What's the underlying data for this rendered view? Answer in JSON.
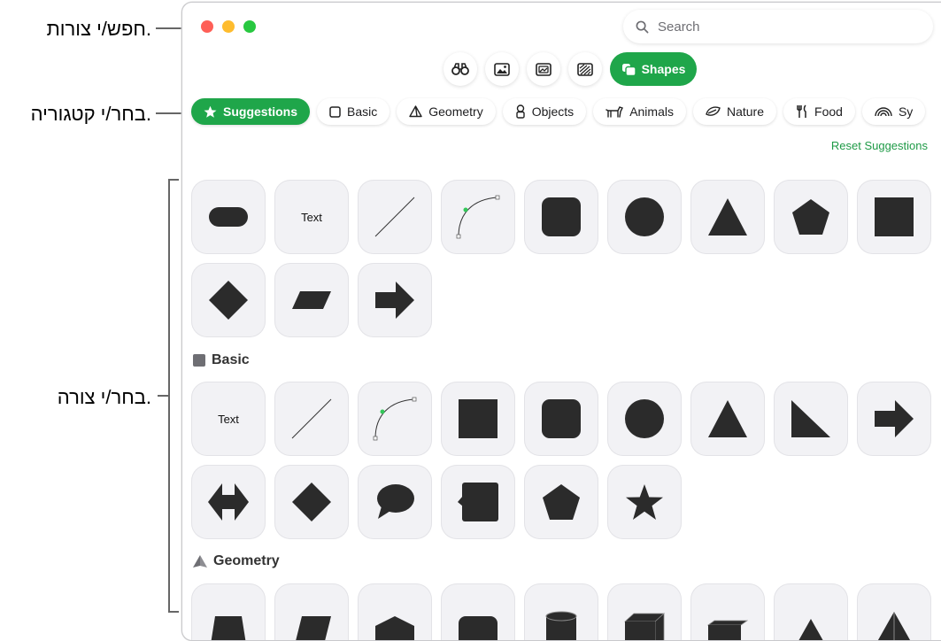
{
  "callouts": {
    "search": "חפש/י צורות.",
    "category": "בחר/י קטגוריה.",
    "shape": "בחר/י צורה."
  },
  "search": {
    "placeholder": "Search"
  },
  "toolbar": {
    "shapes_label": "Shapes"
  },
  "categories": [
    {
      "label": "Suggestions",
      "icon": "star-icon",
      "active": true
    },
    {
      "label": "Basic",
      "icon": "square-outline-icon"
    },
    {
      "label": "Geometry",
      "icon": "pyramid-icon"
    },
    {
      "label": "Objects",
      "icon": "objects-icon"
    },
    {
      "label": "Animals",
      "icon": "animal-icon"
    },
    {
      "label": "Nature",
      "icon": "leaf-icon"
    },
    {
      "label": "Food",
      "icon": "fork-knife-icon"
    },
    {
      "label": "Sy",
      "icon": "rainbow-icon"
    }
  ],
  "reset_label": "Reset Suggestions",
  "tile_text": "Text",
  "sections": {
    "basic": "Basic",
    "geometry": "Geometry"
  },
  "colors": {
    "accent": "#1fa64a",
    "shape_fill": "#2b2b2b",
    "tile_bg": "#f2f2f5"
  }
}
